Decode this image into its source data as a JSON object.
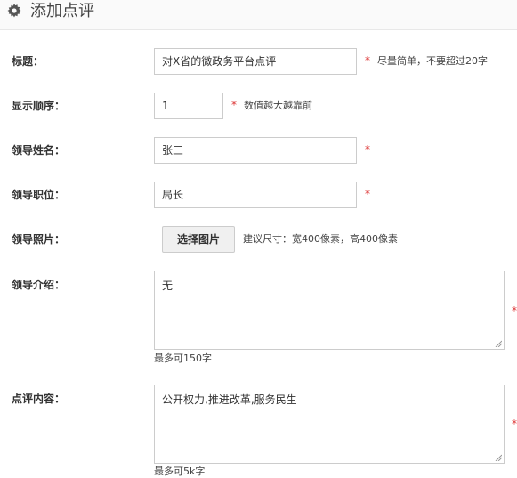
{
  "header": {
    "icon": "gear-icon",
    "title": "添加点评"
  },
  "form": {
    "title": {
      "label": "标题：",
      "value": "对X省的微政务平台点评",
      "required": "*",
      "hint": "尽量简单，不要超过20字"
    },
    "order": {
      "label": "显示顺序：",
      "value": "1",
      "required": "*",
      "hint": "数值越大越靠前"
    },
    "name": {
      "label": "领导姓名：",
      "value": "张三",
      "required": "*"
    },
    "position": {
      "label": "领导职位：",
      "value": "局长",
      "required": "*"
    },
    "photo": {
      "label": "领导照片：",
      "button": "选择图片",
      "hint": "建议尺寸：宽400像素，高400像素"
    },
    "intro": {
      "label": "领导介绍：",
      "value": "无",
      "required": "*",
      "limit": "最多可150字"
    },
    "comment": {
      "label": "点评内容：",
      "value": "公开权力,推进改革,服务民生",
      "required": "*",
      "limit": "最多可5k字"
    }
  },
  "colors": {
    "required": "#dd3333",
    "border": "#cccccc"
  }
}
